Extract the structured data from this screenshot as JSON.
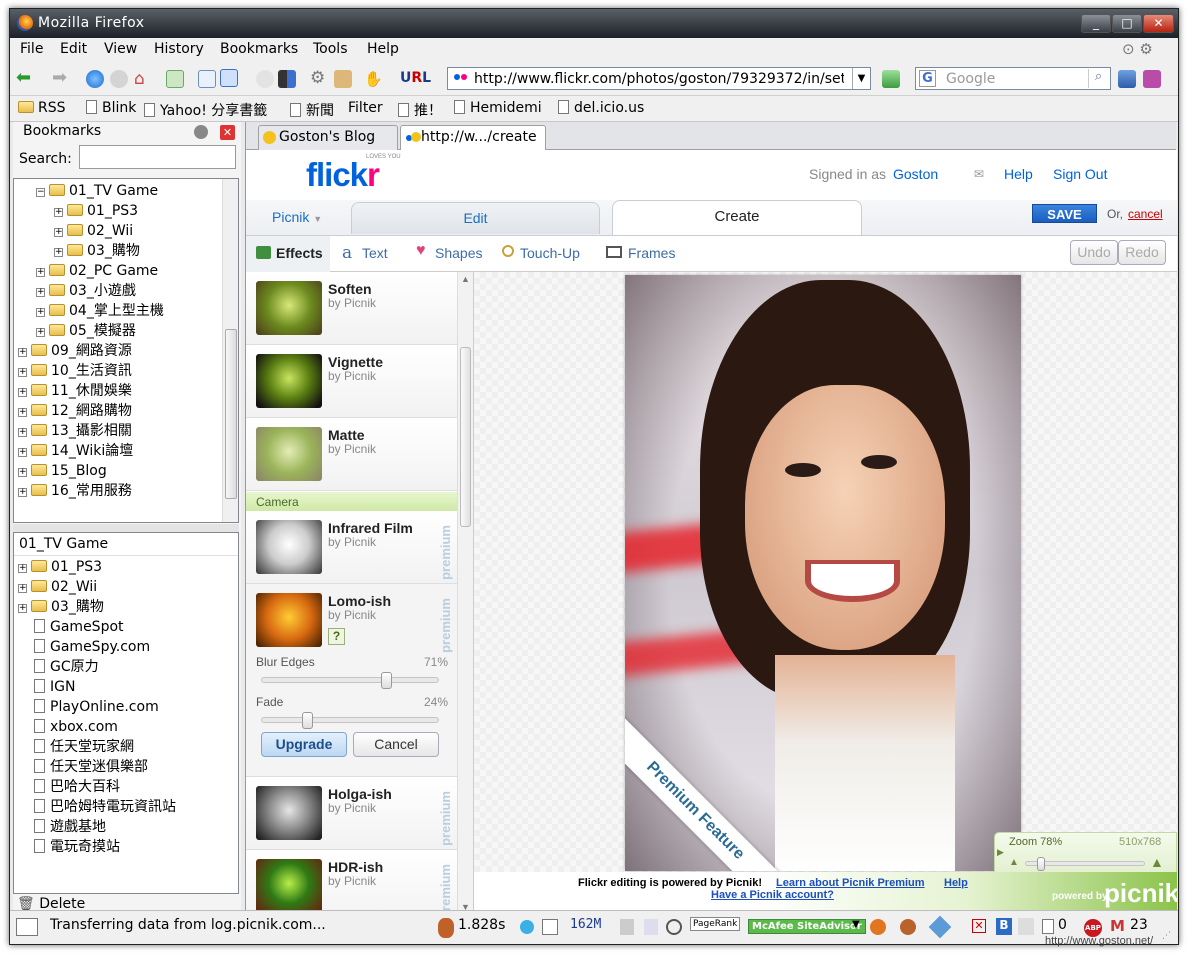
{
  "window": {
    "title": "Mozilla Firefox"
  },
  "menu": [
    "File",
    "Edit",
    "View",
    "History",
    "Bookmarks",
    "Tools",
    "Help"
  ],
  "nav": {
    "url": "http://www.flickr.com/photos/goston/79329372/in/set",
    "search_placeholder": "Google"
  },
  "bookmarks_bar": [
    "RSS",
    "Blink",
    "Yahoo! 分享書籤",
    "新聞",
    "Filter",
    "推！",
    "Hemidemi",
    "del.icio.us"
  ],
  "sidebar": {
    "title": "Bookmarks",
    "search_label": "Search:",
    "tree": [
      {
        "label": "01_TV Game",
        "level": 2,
        "open": true
      },
      {
        "label": "01_PS3",
        "level": 3
      },
      {
        "label": "02_Wii",
        "level": 3
      },
      {
        "label": "03_購物",
        "level": 3
      },
      {
        "label": "02_PC Game",
        "level": 2
      },
      {
        "label": "03_小遊戲",
        "level": 2
      },
      {
        "label": "04_掌上型主機",
        "level": 2
      },
      {
        "label": "05_模擬器",
        "level": 2
      },
      {
        "label": "09_網路資源",
        "level": 1
      },
      {
        "label": "10_生活資訊",
        "level": 1
      },
      {
        "label": "11_休閒娛樂",
        "level": 1
      },
      {
        "label": "12_網路購物",
        "level": 1
      },
      {
        "label": "13_攝影相關",
        "level": 1
      },
      {
        "label": "14_Wiki論壇",
        "level": 1
      },
      {
        "label": "15_Blog",
        "level": 1
      },
      {
        "label": "16_常用服務",
        "level": 1
      }
    ],
    "detail_title": "01_TV Game",
    "folders": [
      "01_PS3",
      "02_Wii",
      "03_購物"
    ],
    "links": [
      "GameSpot",
      "GameSpy.com",
      "GC原力",
      "IGN",
      "PlayOnline.com",
      "xbox.com",
      "任天堂玩家網",
      "任天堂迷俱樂部",
      "巴哈大百科",
      "巴哈姆特電玩資訊站",
      "遊戲基地",
      "電玩奇摸站"
    ],
    "delete_label": "Delete"
  },
  "tabs": [
    {
      "label": "Goston's Blog"
    },
    {
      "label": "http://w.../create"
    }
  ],
  "flickr": {
    "logo": "flickr",
    "loves": "LOVES YOU",
    "signed_in": "Signed in as",
    "user": "Goston",
    "help": "Help",
    "sign_out": "Sign Out"
  },
  "picnik": {
    "menu": "Picnik",
    "tab_edit": "Edit",
    "tab_create": "Create",
    "save": "SAVE",
    "or": "Or,",
    "cancel": "cancel",
    "tools": [
      "Effects",
      "Text",
      "Shapes",
      "Touch-Up",
      "Frames"
    ],
    "undo": "Undo",
    "redo": "Redo",
    "effects_top": [
      {
        "name": "Soften",
        "by": "by Picnik"
      },
      {
        "name": "Vignette",
        "by": "by Picnik"
      },
      {
        "name": "Matte",
        "by": "by Picnik"
      }
    ],
    "camera_header": "Camera",
    "infrared": {
      "name": "Infrared Film",
      "by": "by Picnik",
      "premium": "premium"
    },
    "lomo": {
      "name": "Lomo-ish",
      "by": "by Picnik",
      "premium": "premium",
      "help": "?",
      "blur_label": "Blur Edges",
      "blur_value": "71%",
      "blur_level": 0.71,
      "fade_label": "Fade",
      "fade_value": "24%",
      "fade_level": 0.24,
      "upgrade": "Upgrade",
      "cancel": "Cancel"
    },
    "holga": {
      "name": "Holga-ish",
      "by": "by Picnik",
      "premium": "premium"
    },
    "hdr": {
      "name": "HDR-ish",
      "by": "by Picnik",
      "premium": "premium"
    },
    "banner": "Premium Feature",
    "zoom_label": "Zoom 78%",
    "zoom_size": "510x768",
    "zoom_level": 0.1,
    "footer_text": "Flickr editing is powered by Picnik!",
    "footer_link1": "Learn about Picnik Premium",
    "footer_help": "Help",
    "footer_link2": "Have a Picnik account?",
    "powered": "powered by",
    "brand": "picnik"
  },
  "status": {
    "text": "Transferring data from log.picnik.com...",
    "time": "1.828s",
    "mem": "162M",
    "pagerank": "PageRank",
    "mcafee": "McAfee SiteAdvisor",
    "count0": "0",
    "mail": "23"
  },
  "watermark": "http://www.goston.net/",
  "colors": {
    "flickr_blue": "#0063dc",
    "flickr_pink": "#ff0084",
    "save_bg": "#1a5fc0"
  }
}
